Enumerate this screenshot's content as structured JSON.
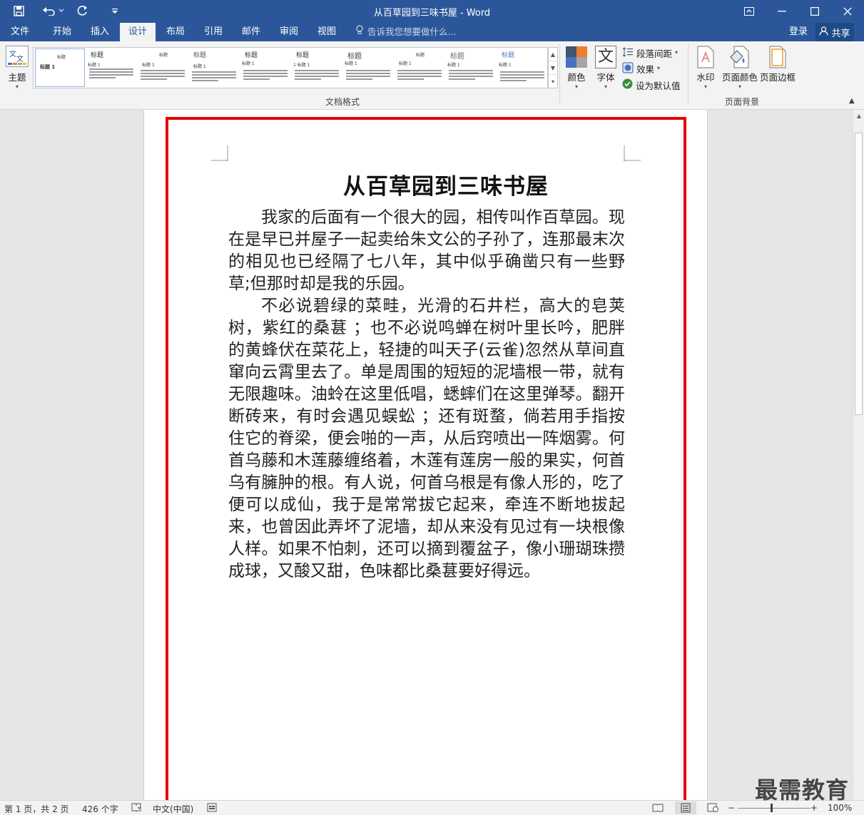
{
  "window": {
    "title": "从百草园到三味书屋 - Word",
    "quick_access": [
      "save-icon",
      "undo-icon",
      "redo-icon",
      "customize-icon"
    ],
    "controls": [
      "ribbon-display-icon",
      "minimize-icon",
      "maximize-icon",
      "close-icon"
    ]
  },
  "tabs": [
    {
      "label": "文件",
      "active": false
    },
    {
      "label": "开始",
      "active": false
    },
    {
      "label": "插入",
      "active": false
    },
    {
      "label": "设计",
      "active": true
    },
    {
      "label": "布局",
      "active": false
    },
    {
      "label": "引用",
      "active": false
    },
    {
      "label": "邮件",
      "active": false
    },
    {
      "label": "审阅",
      "active": false
    },
    {
      "label": "视图",
      "active": false
    }
  ],
  "tell_me": "告诉我您想要做什么...",
  "signin": "登录",
  "share": "共享",
  "ribbon": {
    "themes_label": "主题",
    "style_gallery": [
      {
        "title": "标题",
        "heading": "标题 1"
      },
      {
        "title": "标题",
        "heading": "标题 1"
      },
      {
        "title": "标题",
        "heading": "标题 1"
      },
      {
        "title": "标题",
        "heading": "标题 1"
      },
      {
        "title": "标题",
        "heading": "标题 1"
      },
      {
        "title": "标题",
        "heading": "1 标题 1"
      },
      {
        "title": "标题",
        "heading": "标题 1"
      },
      {
        "title": "标题",
        "heading": "标题 1"
      },
      {
        "title": "标题",
        "heading": "标题 1"
      },
      {
        "title": "标题",
        "heading": "标题 1"
      }
    ],
    "doc_format_label": "文档格式",
    "colors_label": "颜色",
    "fonts_label": "字体",
    "fonts_glyph": "文",
    "paragraph_spacing_label": "段落间距",
    "effects_label": "效果",
    "set_default_label": "设为默认值",
    "watermark_label": "水印",
    "page_color_label": "页面颜色",
    "page_borders_label": "页面边框",
    "page_background_label": "页面背景"
  },
  "document": {
    "heading": "从百草园到三味书屋",
    "paragraphs": [
      "我家的后面有一个很大的园，相传叫作百草园。现在是早已并屋子一起卖给朱文公的子孙了，连那最末次的相见也已经隔了七八年，其中似乎确凿只有一些野草;但那时却是我的乐园。",
      "不必说碧绿的菜畦，光滑的石井栏，高大的皂荚树，紫红的桑葚 ；也不必说鸣蝉在树叶里长吟，肥胖的黄蜂伏在菜花上，轻捷的叫天子(云雀)忽然从草间直窜向云霄里去了。单是周围的短短的泥墙根一带，就有无限趣味。油蛉在这里低唱，蟋蟀们在这里弹琴。翻开断砖来，有时会遇见蜈蚣 ；还有斑蝥，倘若用手指按住它的脊梁，便会啪的一声，从后窍喷出一阵烟雾。何首乌藤和木莲藤缠络着，木莲有莲房一般的果实，何首乌有臃肿的根。有人说，何首乌根是有像人形的，吃了便可以成仙，我于是常常拔它起来，牵连不断地拔起来，也曾因此弄坏了泥墙，却从来没有见过有一块根像人样。如果不怕刺，还可以摘到覆盆子，像小珊瑚珠攒成球，又酸又甜，色味都比桑葚要好得远。"
    ]
  },
  "statusbar": {
    "page_info": "第 1 页，共 2 页",
    "word_count": "426 个字",
    "language": "中文(中国)",
    "zoom_label": "100%",
    "zoom_percent": 100
  },
  "logo_text": "最需教育",
  "colors": {
    "titlebar": "#2b579a",
    "highlight_frame": "#e60000"
  }
}
